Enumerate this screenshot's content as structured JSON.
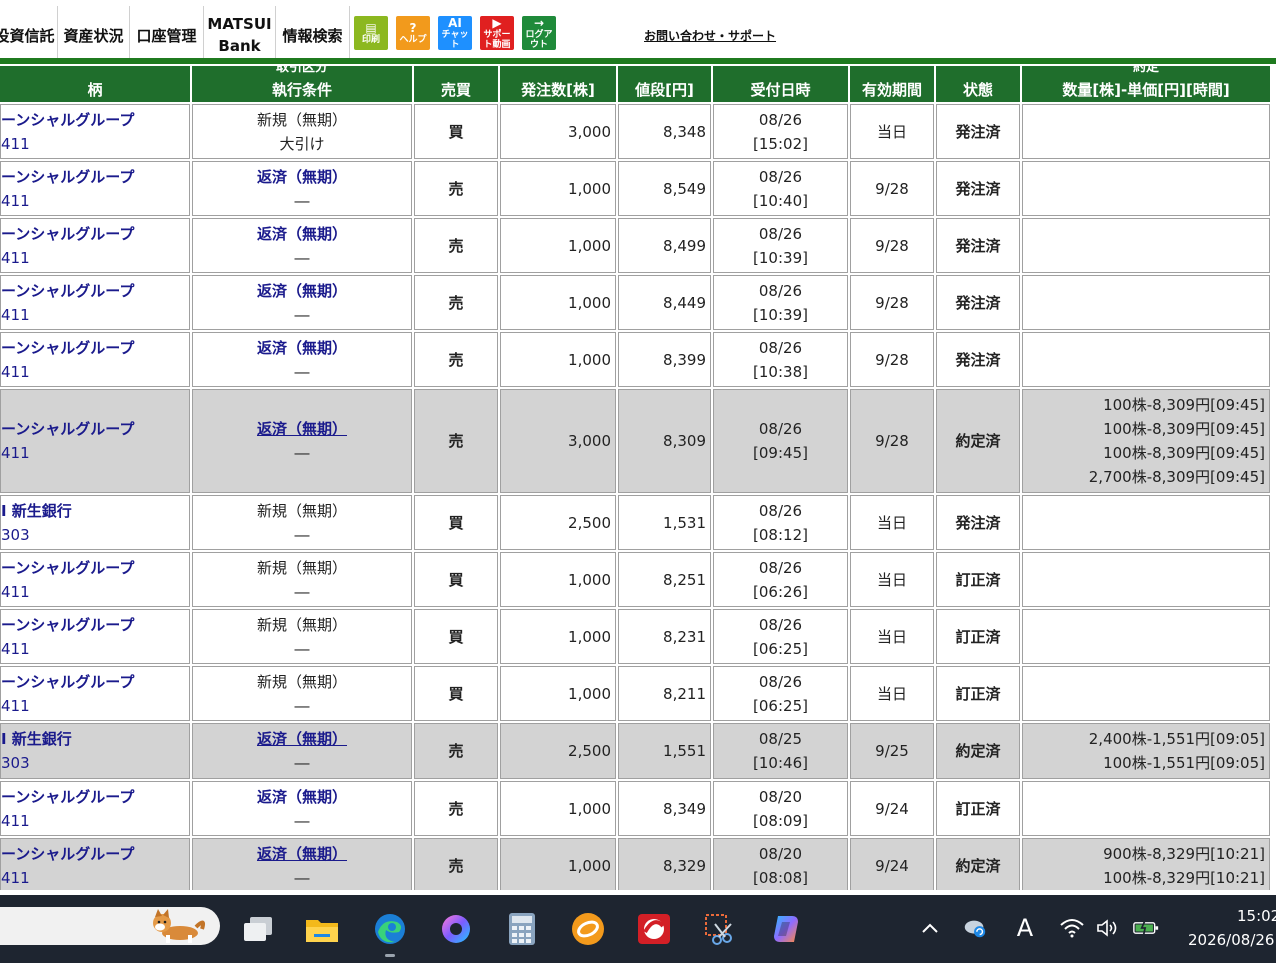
{
  "nav": {
    "items": [
      "投資信託",
      "資産状況",
      "口座管理",
      "情報検索"
    ],
    "bank": [
      "MATSUI",
      "Bank"
    ],
    "tools": [
      {
        "glyph": "▤",
        "label": "印刷",
        "color": "#8cb820"
      },
      {
        "glyph": "?",
        "label": "ヘルプ",
        "color": "#f29a1c"
      },
      {
        "glyph": "AI",
        "label": "チャット",
        "color": "#1e90ff"
      },
      {
        "glyph": "▶",
        "label": "サポート動画",
        "color": "#e02020"
      },
      {
        "glyph": "→",
        "label": "ログアウト",
        "color": "#1f8a3a"
      }
    ],
    "support": "お問い合わせ・サポート"
  },
  "table": {
    "headers": {
      "name": "柄",
      "condition_top": "取引区分",
      "condition": "執行条件",
      "side": "売買",
      "qty": "発注数[株]",
      "price": "値段[円]",
      "received": "受付日時",
      "validity": "有効期間",
      "status": "状態",
      "exec_top": "約定",
      "exec": "数量[株]-単価[円][時間]"
    },
    "rows": [
      {
        "name": "ーンシャルグループ",
        "code": "411",
        "type": "新規（無期）",
        "cond": "大引け",
        "type_link": false,
        "side": "買",
        "qty": "3,000",
        "price": "8,348",
        "date": "08/26",
        "time": "[15:02]",
        "valid": "当日",
        "status": "発注済",
        "filled": false,
        "execs": []
      },
      {
        "name": "ーンシャルグループ",
        "code": "411",
        "type": "返済（無期）",
        "cond": "―",
        "type_link": true,
        "side": "売",
        "qty": "1,000",
        "price": "8,549",
        "date": "08/26",
        "time": "[10:40]",
        "valid": "9/28",
        "status": "発注済",
        "filled": false,
        "execs": []
      },
      {
        "name": "ーンシャルグループ",
        "code": "411",
        "type": "返済（無期）",
        "cond": "―",
        "type_link": true,
        "side": "売",
        "qty": "1,000",
        "price": "8,499",
        "date": "08/26",
        "time": "[10:39]",
        "valid": "9/28",
        "status": "発注済",
        "filled": false,
        "execs": []
      },
      {
        "name": "ーンシャルグループ",
        "code": "411",
        "type": "返済（無期）",
        "cond": "―",
        "type_link": true,
        "side": "売",
        "qty": "1,000",
        "price": "8,449",
        "date": "08/26",
        "time": "[10:39]",
        "valid": "9/28",
        "status": "発注済",
        "filled": false,
        "execs": []
      },
      {
        "name": "ーンシャルグループ",
        "code": "411",
        "type": "返済（無期）",
        "cond": "―",
        "type_link": true,
        "side": "売",
        "qty": "1,000",
        "price": "8,399",
        "date": "08/26",
        "time": "[10:38]",
        "valid": "9/28",
        "status": "発注済",
        "filled": false,
        "execs": []
      },
      {
        "name": "ーンシャルグループ",
        "code": "411",
        "type": "返済（無期）",
        "cond": "―",
        "type_link": true,
        "side": "売",
        "qty": "3,000",
        "price": "8,309",
        "date": "08/26",
        "time": "[09:45]",
        "valid": "9/28",
        "status": "約定済",
        "filled": true,
        "execs": [
          "100株-8,309円[09:45]",
          "100株-8,309円[09:45]",
          "100株-8,309円[09:45]",
          "2,700株-8,309円[09:45]"
        ]
      },
      {
        "name": "I 新生銀行",
        "code": "303",
        "type": "新規（無期）",
        "cond": "―",
        "type_link": false,
        "side": "買",
        "qty": "2,500",
        "price": "1,531",
        "date": "08/26",
        "time": "[08:12]",
        "valid": "当日",
        "status": "発注済",
        "filled": false,
        "execs": []
      },
      {
        "name": "ーンシャルグループ",
        "code": "411",
        "type": "新規（無期）",
        "cond": "―",
        "type_link": false,
        "side": "買",
        "qty": "1,000",
        "price": "8,251",
        "date": "08/26",
        "time": "[06:26]",
        "valid": "当日",
        "status": "訂正済",
        "filled": false,
        "execs": []
      },
      {
        "name": "ーンシャルグループ",
        "code": "411",
        "type": "新規（無期）",
        "cond": "―",
        "type_link": false,
        "side": "買",
        "qty": "1,000",
        "price": "8,231",
        "date": "08/26",
        "time": "[06:25]",
        "valid": "当日",
        "status": "訂正済",
        "filled": false,
        "execs": []
      },
      {
        "name": "ーンシャルグループ",
        "code": "411",
        "type": "新規（無期）",
        "cond": "―",
        "type_link": false,
        "side": "買",
        "qty": "1,000",
        "price": "8,211",
        "date": "08/26",
        "time": "[06:25]",
        "valid": "当日",
        "status": "訂正済",
        "filled": false,
        "execs": []
      },
      {
        "name": "I 新生銀行",
        "code": "303",
        "type": "返済（無期）",
        "cond": "―",
        "type_link": true,
        "side": "売",
        "qty": "2,500",
        "price": "1,551",
        "date": "08/25",
        "time": "[10:46]",
        "valid": "9/25",
        "status": "約定済",
        "filled": true,
        "execs": [
          "2,400株-1,551円[09:05]",
          "100株-1,551円[09:05]"
        ]
      },
      {
        "name": "ーンシャルグループ",
        "code": "411",
        "type": "返済（無期）",
        "cond": "―",
        "type_link": true,
        "side": "売",
        "qty": "1,000",
        "price": "8,349",
        "date": "08/20",
        "time": "[08:09]",
        "valid": "9/24",
        "status": "訂正済",
        "filled": false,
        "execs": []
      },
      {
        "name": "ーンシャルグループ",
        "code": "411",
        "type": "返済（無期）",
        "cond": "―",
        "type_link": true,
        "side": "売",
        "qty": "1,000",
        "price": "8,329",
        "date": "08/20",
        "time": "[08:08]",
        "valid": "9/24",
        "status": "約定済",
        "filled": true,
        "execs": [
          "900株-8,329円[10:21]",
          "100株-8,329円[10:21]"
        ]
      }
    ]
  },
  "taskbar": {
    "apps": [
      "task-view-icon",
      "file-explorer-icon",
      "edge-browser-icon",
      "copilot-app-icon",
      "calculator-icon",
      "app-orange-icon",
      "trend-micro-icon",
      "snipping-tool-icon",
      "copilot-icon"
    ],
    "ime": "A",
    "time": "15:02",
    "date": "2026/08/26"
  }
}
